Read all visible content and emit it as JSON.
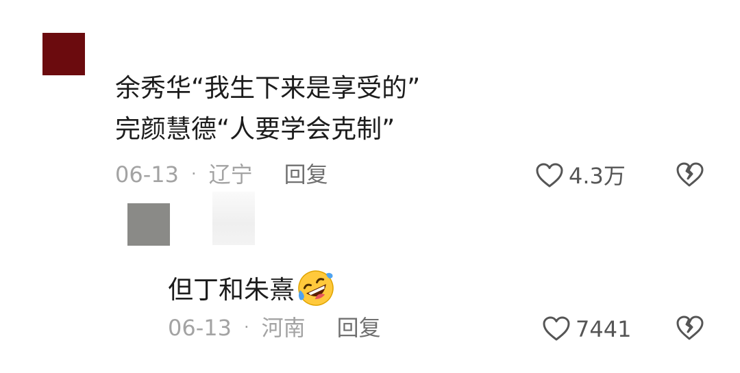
{
  "main_comment": {
    "avatar_color": "#6b0b0e",
    "text_line1": "余秀华“我生下来是享受的”",
    "text_line2": "完颜慧德“人要学会克制”",
    "date": "06-13",
    "separator": "·",
    "location": "辽宁",
    "reply_label": "回复",
    "likes": "4.3万",
    "like_icon": "heart-outline-icon",
    "dislike_icon": "broken-heart-icon"
  },
  "reply_comment": {
    "avatar_color": "#8a8a87",
    "text": "但丁和朱熹",
    "emoji": "rolling-on-floor-laughing-emoji",
    "date": "06-13",
    "separator": "·",
    "location": "河南",
    "reply_label": "回复",
    "likes": "7441",
    "like_icon": "heart-outline-icon",
    "dislike_icon": "broken-heart-icon"
  }
}
